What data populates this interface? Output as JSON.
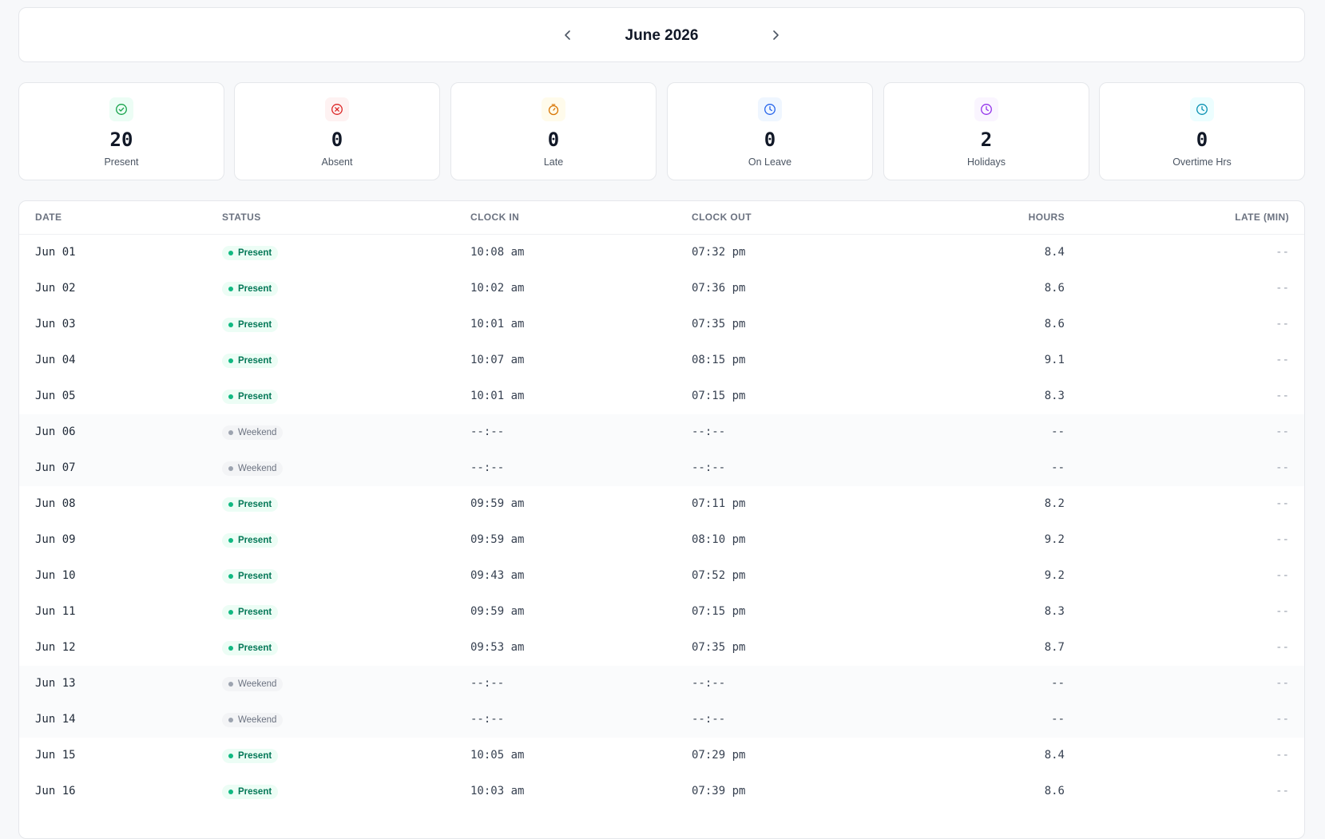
{
  "header": {
    "month_label": "June 2026",
    "prev_icon": "chevron-left-icon",
    "next_icon": "chevron-right-icon"
  },
  "stats": [
    {
      "id": "present",
      "value": "20",
      "label": "Present",
      "icon": "check-circle-icon",
      "color": "#16a34a",
      "bg": "#ecfdf5"
    },
    {
      "id": "absent",
      "value": "0",
      "label": "Absent",
      "icon": "x-circle-icon",
      "color": "#dc2626",
      "bg": "#fef2f2"
    },
    {
      "id": "late",
      "value": "0",
      "label": "Late",
      "icon": "stopwatch-icon",
      "color": "#d97706",
      "bg": "#fffbeb"
    },
    {
      "id": "on-leave",
      "value": "0",
      "label": "On Leave",
      "icon": "clock-icon",
      "color": "#2563eb",
      "bg": "#eff6ff"
    },
    {
      "id": "holidays",
      "value": "2",
      "label": "Holidays",
      "icon": "clock-icon",
      "color": "#9333ea",
      "bg": "#faf5ff"
    },
    {
      "id": "overtime",
      "value": "0",
      "label": "Overtime Hrs",
      "icon": "clock-icon",
      "color": "#0891b2",
      "bg": "#ecfeff"
    }
  ],
  "table": {
    "columns": {
      "date": "DATE",
      "status": "STATUS",
      "clock_in": "CLOCK IN",
      "clock_out": "CLOCK OUT",
      "hours": "HOURS",
      "late": "LATE (MIN)"
    },
    "rows": [
      {
        "date": "Jun 01",
        "status": "Present",
        "clock_in": "10:08 am",
        "clock_out": "07:32 pm",
        "hours": "8.4",
        "late": "--"
      },
      {
        "date": "Jun 02",
        "status": "Present",
        "clock_in": "10:02 am",
        "clock_out": "07:36 pm",
        "hours": "8.6",
        "late": "--"
      },
      {
        "date": "Jun 03",
        "status": "Present",
        "clock_in": "10:01 am",
        "clock_out": "07:35 pm",
        "hours": "8.6",
        "late": "--"
      },
      {
        "date": "Jun 04",
        "status": "Present",
        "clock_in": "10:07 am",
        "clock_out": "08:15 pm",
        "hours": "9.1",
        "late": "--"
      },
      {
        "date": "Jun 05",
        "status": "Present",
        "clock_in": "10:01 am",
        "clock_out": "07:15 pm",
        "hours": "8.3",
        "late": "--"
      },
      {
        "date": "Jun 06",
        "status": "Weekend",
        "clock_in": "--:--",
        "clock_out": "--:--",
        "hours": "--",
        "late": "--"
      },
      {
        "date": "Jun 07",
        "status": "Weekend",
        "clock_in": "--:--",
        "clock_out": "--:--",
        "hours": "--",
        "late": "--"
      },
      {
        "date": "Jun 08",
        "status": "Present",
        "clock_in": "09:59 am",
        "clock_out": "07:11 pm",
        "hours": "8.2",
        "late": "--"
      },
      {
        "date": "Jun 09",
        "status": "Present",
        "clock_in": "09:59 am",
        "clock_out": "08:10 pm",
        "hours": "9.2",
        "late": "--"
      },
      {
        "date": "Jun 10",
        "status": "Present",
        "clock_in": "09:43 am",
        "clock_out": "07:52 pm",
        "hours": "9.2",
        "late": "--"
      },
      {
        "date": "Jun 11",
        "status": "Present",
        "clock_in": "09:59 am",
        "clock_out": "07:15 pm",
        "hours": "8.3",
        "late": "--"
      },
      {
        "date": "Jun 12",
        "status": "Present",
        "clock_in": "09:53 am",
        "clock_out": "07:35 pm",
        "hours": "8.7",
        "late": "--"
      },
      {
        "date": "Jun 13",
        "status": "Weekend",
        "clock_in": "--:--",
        "clock_out": "--:--",
        "hours": "--",
        "late": "--"
      },
      {
        "date": "Jun 14",
        "status": "Weekend",
        "clock_in": "--:--",
        "clock_out": "--:--",
        "hours": "--",
        "late": "--"
      },
      {
        "date": "Jun 15",
        "status": "Present",
        "clock_in": "10:05 am",
        "clock_out": "07:29 pm",
        "hours": "8.4",
        "late": "--"
      },
      {
        "date": "Jun 16",
        "status": "Present",
        "clock_in": "10:03 am",
        "clock_out": "07:39 pm",
        "hours": "8.6",
        "late": "--"
      }
    ]
  }
}
